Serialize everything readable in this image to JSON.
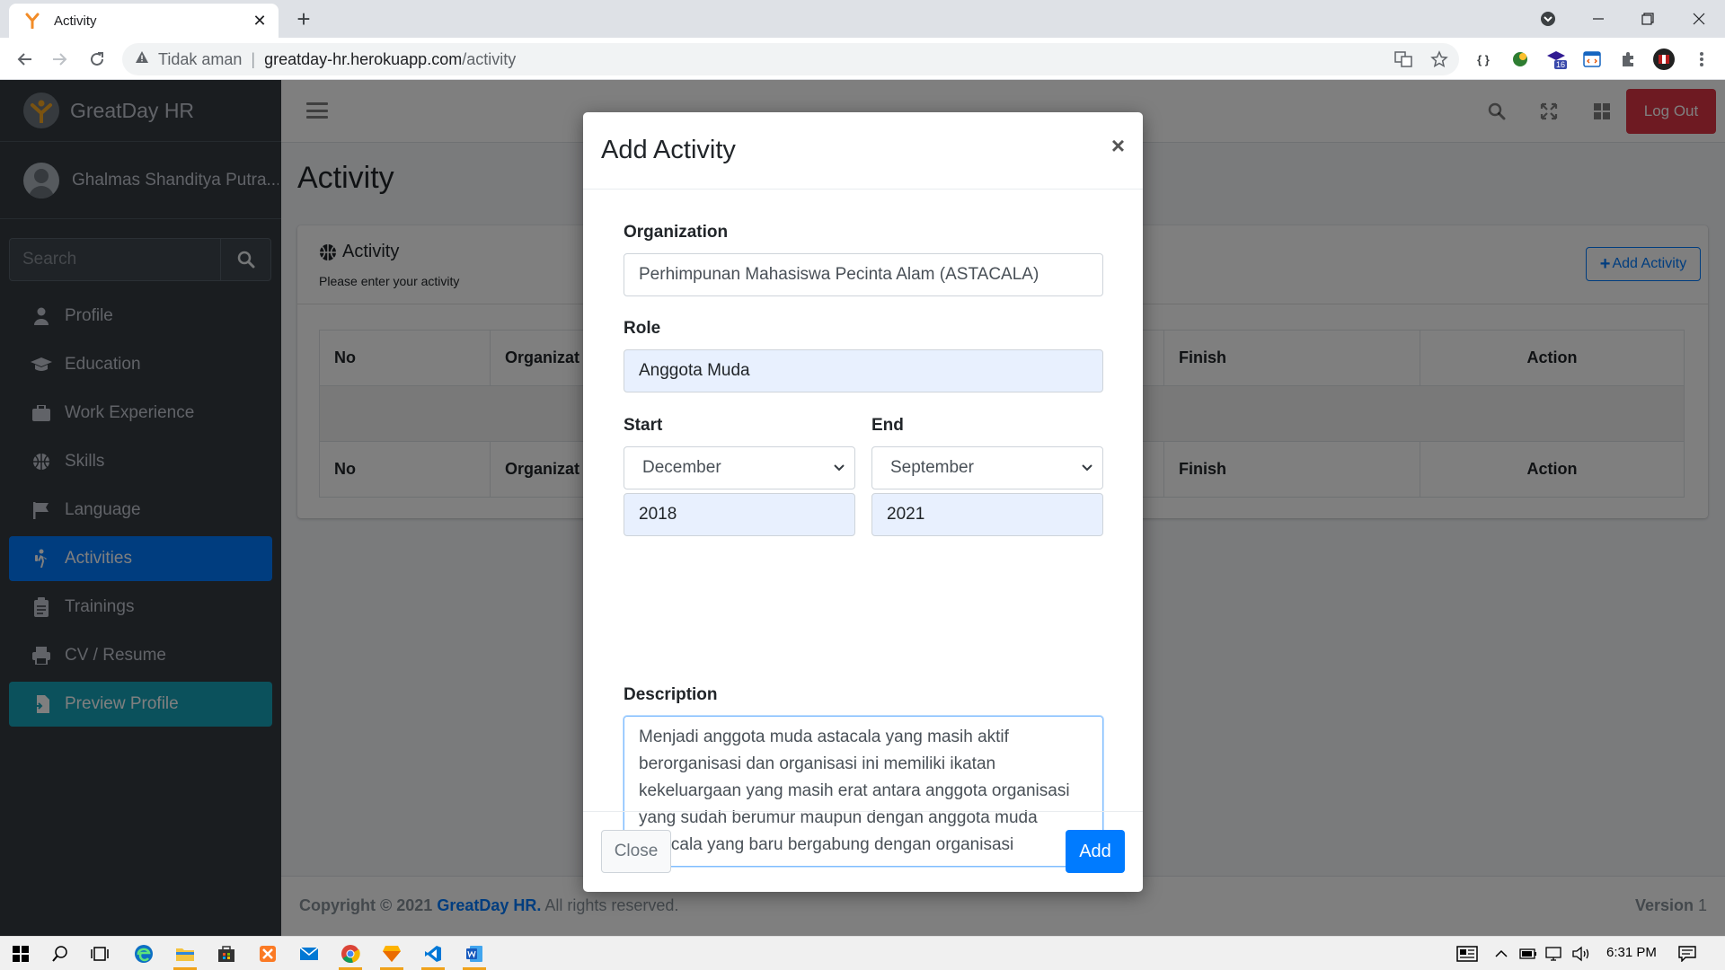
{
  "browser": {
    "tab_title": "Activity",
    "tab_close": "✕",
    "new_tab": "+",
    "security_label": "Tidak aman",
    "separator": "|",
    "url_host": "greatday-hr.herokuapp.com",
    "url_path": "/activity",
    "profile_badge": "16"
  },
  "sidebar": {
    "brand": "GreatDay HR",
    "user_name": "Ghalmas Shanditya Putra...",
    "search_placeholder": "Search",
    "items": [
      {
        "label": "Profile",
        "icon": "user-icon"
      },
      {
        "label": "Education",
        "icon": "graduation-cap-icon"
      },
      {
        "label": "Work Experience",
        "icon": "briefcase-icon"
      },
      {
        "label": "Skills",
        "icon": "basketball-icon"
      },
      {
        "label": "Language",
        "icon": "flag-icon"
      },
      {
        "label": "Activities",
        "icon": "hiking-icon",
        "active": true
      },
      {
        "label": "Trainings",
        "icon": "clipboard-icon"
      },
      {
        "label": "CV / Resume",
        "icon": "print-icon"
      },
      {
        "label": "Preview Profile",
        "icon": "file-import-icon"
      }
    ]
  },
  "topnav": {
    "logout_label": "Log Out"
  },
  "page": {
    "title": "Activity",
    "card_title": "Activity",
    "card_subtitle": "Please enter your activity",
    "add_button": "Add Activity",
    "table_headers": [
      "No",
      "Organizat",
      "Finish",
      "Action"
    ],
    "table_footers": [
      "No",
      "Organizat",
      "Finish",
      "Action"
    ]
  },
  "footer": {
    "copyright_prefix": "Copyright © 2021 ",
    "brand": "GreatDay HR.",
    "suffix": " All rights reserved.",
    "version_label": "Version",
    "version_value": " 1"
  },
  "modal": {
    "title": "Add Activity",
    "close_x": "×",
    "organization_label": "Organization",
    "organization_value": "Perhimpunan Mahasiswa Pecinta Alam (ASTACALA)",
    "role_label": "Role",
    "role_value": "Anggota Muda",
    "start_label": "Start",
    "end_label": "End",
    "start_month": "December",
    "end_month": "September",
    "start_year": "2018",
    "end_year": "2021",
    "description_label": "Description",
    "description_lines": [
      "Menjadi anggota muda astacala yang masih aktif",
      "berorganisasi dan organisasi ini memiliki ikatan",
      "kekeluargaan yang masih erat antara anggota organisasi",
      "yang sudah berumur maupun dengan anggota muda",
      "astacala yang baru bergabung dengan organisasi"
    ],
    "close_button": "Close",
    "add_button": "Add"
  },
  "taskbar": {
    "time": "6:31 PM"
  },
  "colors": {
    "primary": "#007bff",
    "danger": "#dc3545",
    "info": "#17a2b8",
    "sidebar": "#343a40"
  }
}
